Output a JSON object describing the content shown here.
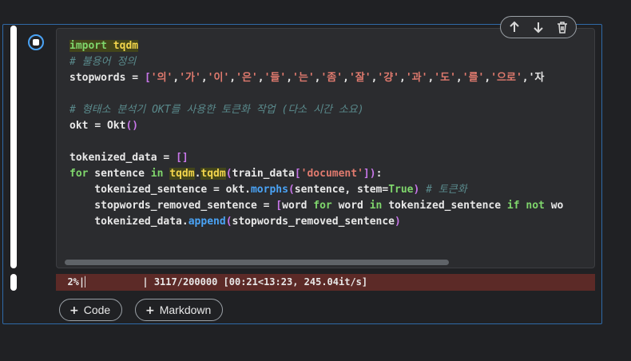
{
  "toolbar": {
    "move_up_icon": "arrow-up",
    "move_down_icon": "arrow-down",
    "delete_icon": "trash"
  },
  "run_button_icon": "stop-square",
  "code_lines": [
    "import tqdm",
    "# 불용어 정의",
    "stopwords = ['의','가','이','은','들','는','좀','잘','걍','과','도','를','으로','자",
    "",
    "# 형태소 분석기 OKT를 사용한 토큰화 작업 (다소 시간 소요)",
    "okt = Okt()",
    "",
    "tokenized_data = []",
    "for sentence in tqdm.tqdm(train_data['document']):",
    "    tokenized_sentence = okt.morphs(sentence, stem=True) # 토큰화",
    "    stopwords_removed_sentence = [word for word in tokenized_sentence if not wo",
    "    tokenized_data.append(stopwords_removed_sentence)"
  ],
  "output": {
    "text": "  2%|▏         | 3117/200000 [00:21<13:23, 245.04it/s]"
  },
  "add_buttons": {
    "code_label": "Code",
    "markdown_label": "Markdown"
  },
  "colors": {
    "accent": "#4aa3f5",
    "keyword": "#7fd66c",
    "comment": "#5a8a8c",
    "string": "#e07a6e",
    "output_bg": "#5c2a27"
  }
}
